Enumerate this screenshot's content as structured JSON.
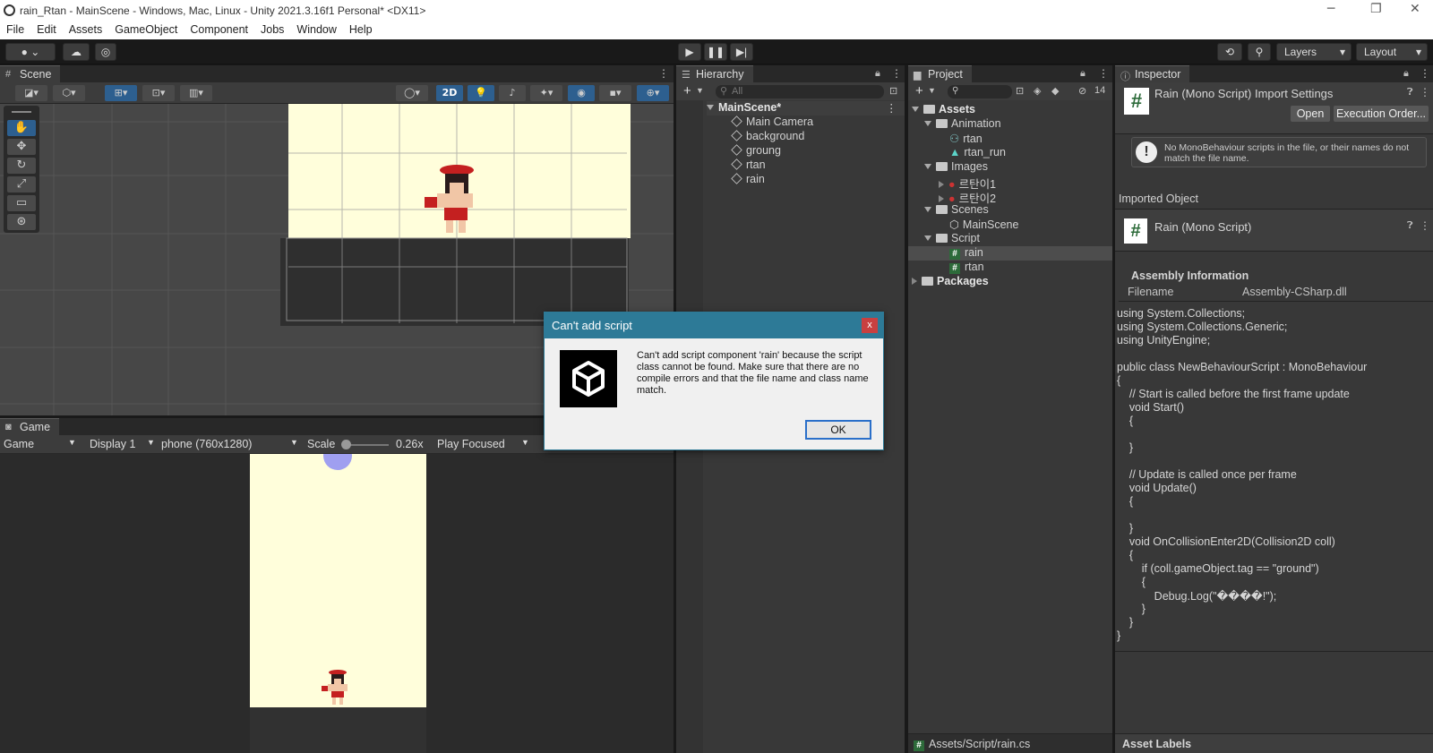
{
  "window": {
    "title": "rain_Rtan - MainScene - Windows, Mac, Linux - Unity 2021.3.16f1 Personal* <DX11>",
    "min": "─",
    "max": "❐",
    "close": "✕"
  },
  "menu": [
    "File",
    "Edit",
    "Assets",
    "GameObject",
    "Component",
    "Jobs",
    "Window",
    "Help"
  ],
  "toolbar": {
    "layers": "Layers",
    "layout": "Layout"
  },
  "scene": {
    "tab": "Scene",
    "mode_2d": "2D"
  },
  "game": {
    "tab": "Game",
    "view": "Game",
    "display": "Display 1",
    "resolution": "phone (760x1280)",
    "scale_label": "Scale",
    "scale_value": "0.26x",
    "play_mode": "Play Focused"
  },
  "hierarchy": {
    "tab": "Hierarchy",
    "search_placeholder": "All",
    "scene": "MainScene*",
    "items": [
      "Main Camera",
      "background",
      "groung",
      "rtan",
      "rain"
    ]
  },
  "project": {
    "tab": "Project",
    "hidden_count": "14",
    "assets": "Assets",
    "animation": "Animation",
    "anim_items": [
      "rtan",
      "rtan_run"
    ],
    "images": "Images",
    "image_items": [
      "르탄이1",
      "르탄이2"
    ],
    "scenes": "Scenes",
    "scene_items": [
      "MainScene"
    ],
    "script": "Script",
    "script_items": [
      "rain",
      "rtan"
    ],
    "packages": "Packages",
    "footer": "Assets/Script/rain.cs"
  },
  "inspector": {
    "tab": "Inspector",
    "title": "Rain (Mono Script) Import Settings",
    "open": "Open",
    "exec_order": "Execution Order...",
    "warning": "No MonoBehaviour scripts in the file, or their names do not match the file name.",
    "imported_object": "Imported Object",
    "object_name": "Rain (Mono Script)",
    "assembly_info": "Assembly Information",
    "filename_label": "Filename",
    "filename_value": "Assembly-CSharp.dll",
    "asset_labels": "Asset Labels",
    "code": [
      "using System.Collections;",
      "using System.Collections.Generic;",
      "using UnityEngine;",
      "",
      "public class NewBehaviourScript : MonoBehaviour",
      "{",
      "    // Start is called before the first frame update",
      "    void Start()",
      "    {",
      "",
      "    }",
      "",
      "    // Update is called once per frame",
      "    void Update()",
      "    {",
      "",
      "    }",
      "    void OnCollisionEnter2D(Collision2D coll)",
      "    {",
      "        if (coll.gameObject.tag == \"ground\")",
      "        {",
      "            Debug.Log(\"����!\");",
      "        }",
      "    }",
      "}"
    ]
  },
  "dialog": {
    "title": "Can't add script",
    "message": "Can't add script component 'rain' because the script class cannot be found. Make sure that there are no compile errors and that the file name and class name match.",
    "ok": "OK",
    "close": "x"
  }
}
